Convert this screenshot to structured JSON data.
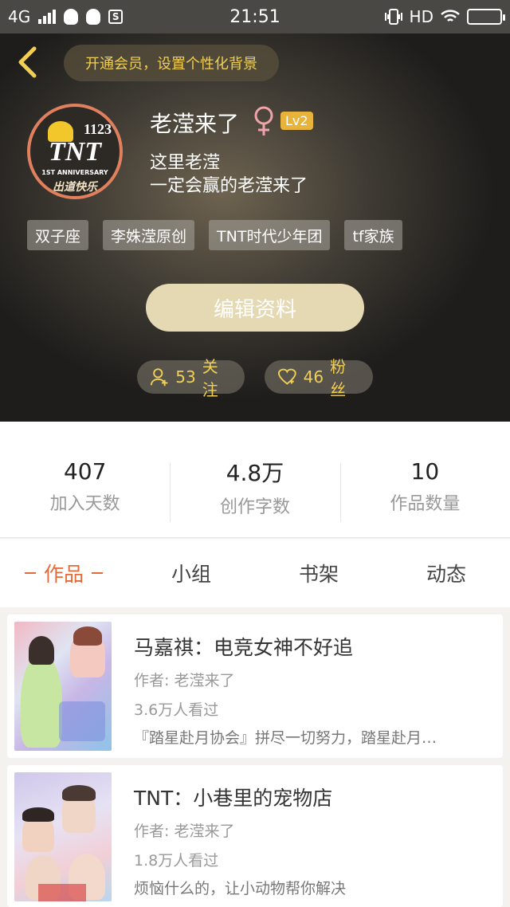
{
  "status_bar": {
    "network": "4G",
    "time": "21:51",
    "hd": "HD",
    "s_badge": "S"
  },
  "header": {
    "vip_prompt": "开通会员，设置个性化背景",
    "avatar": {
      "number": "1123",
      "brand": "TNT",
      "subtitle": "1ST ANNIVERSARY",
      "caption": "出道快乐"
    },
    "username": "老滢来了",
    "gender_symbol": "♀",
    "level": "Lv2",
    "bio_line1": "这里老滢",
    "bio_line2": "一定会赢的老滢来了",
    "tags": [
      "双子座",
      "李姝滢原创",
      "TNT时代少年团",
      "tf家族"
    ],
    "edit_button": "编辑资料",
    "follow_count": "53",
    "follow_label": "关注",
    "fans_count": "46",
    "fans_label": "粉丝"
  },
  "stats": [
    {
      "value": "407",
      "label": "加入天数"
    },
    {
      "value": "4.8万",
      "label": "创作字数"
    },
    {
      "value": "10",
      "label": "作品数量"
    }
  ],
  "tabs": [
    "作品",
    "小组",
    "书架",
    "动态"
  ],
  "works": [
    {
      "title": "马嘉祺：电竞女神不好追",
      "author": "作者: 老滢来了",
      "views": "3.6万人看过",
      "desc": "『踏星赴月协会』拼尽一切努力，踏星赴月…"
    },
    {
      "title": "TNT：小巷里的宠物店",
      "author": "作者: 老滢来了",
      "views": "1.8万人看过",
      "desc": "烦恼什么的，让小动物帮你解决"
    }
  ],
  "colors": {
    "accent": "#e56a3a",
    "gold": "#f1cf55",
    "edit_button": "#e5d9b4"
  }
}
